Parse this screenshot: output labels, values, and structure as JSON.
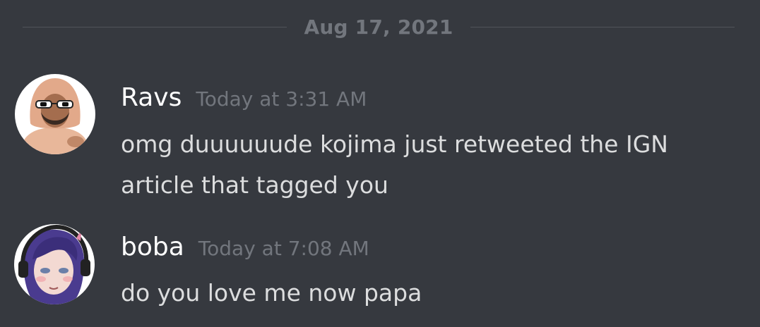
{
  "divider": {
    "date": "Aug 17, 2021"
  },
  "messages": [
    {
      "username": "Ravs",
      "timestamp": "Today at 3:31 AM",
      "lines": [
        "omg duuuuuude kojima just retweeted the IGN",
        "article that tagged you"
      ]
    },
    {
      "username": "boba",
      "timestamp": "Today at 7:08 AM",
      "lines": [
        "do you love me now papa"
      ]
    }
  ],
  "colors": {
    "background": "#36393f",
    "username": "#ffffff",
    "timestamp": "#72767d",
    "text": "#dcddde",
    "divider_line": "#50535a"
  }
}
